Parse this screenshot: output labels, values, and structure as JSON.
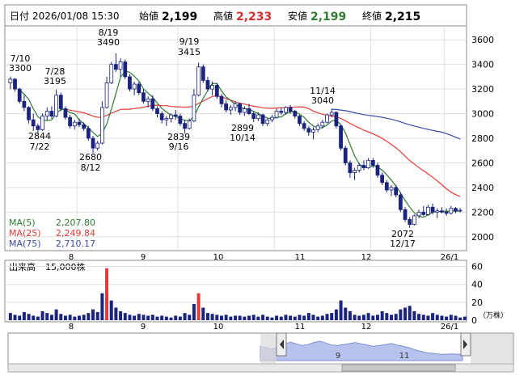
{
  "header": {
    "date_label": "日付",
    "datetime": "2026/01/08 15:30",
    "open_label": "始値",
    "open_value": "2,199",
    "high_label": "高値",
    "high_value": "2,233",
    "low_label": "安値",
    "low_value": "2,199",
    "close_label": "終値",
    "close_value": "2,215"
  },
  "legend": {
    "ma5_label": "MA(5)",
    "ma5_value": "2,207.80",
    "ma25_label": "MA(25)",
    "ma25_value": "2,249.84",
    "ma75_label": "MA(75)",
    "ma75_value": "2,710.17"
  },
  "volume_header": {
    "label": "出来高",
    "value": "15,000株"
  },
  "volume_unit": "（万株）",
  "navigator": {
    "tick_labels": [
      "9",
      "11"
    ]
  },
  "colors": {
    "up": "#ffffff",
    "down": "#1a237e",
    "candle_edge": "#1a237e",
    "ma5": "#2e7d32",
    "ma25": "#e53935",
    "ma75": "#3949ab",
    "volume_blue": "#1a237e",
    "volume_red": "#e53935",
    "open_value": "#000000",
    "high_value": "#d32f2f",
    "low_value": "#2e7d32"
  },
  "chart_data": {
    "type": "candlestick",
    "price_axis": {
      "ticks": [
        "2000",
        "2200",
        "2400",
        "2600",
        "2800",
        "3000",
        "3200",
        "3400",
        "3600"
      ],
      "ylim": [
        1900,
        3700
      ]
    },
    "volume_axis": {
      "ticks": [
        "0",
        "20",
        "40",
        "60"
      ],
      "ylim": [
        0,
        65
      ]
    },
    "x_tick_labels": [
      "8",
      "9",
      "10",
      "11",
      "12",
      "26/1"
    ],
    "annotations": [
      {
        "label": "7/10",
        "value": "3300"
      },
      {
        "label": "7/22",
        "value": "2844"
      },
      {
        "label": "7/28",
        "value": "3195"
      },
      {
        "label": "8/12",
        "value": "2680"
      },
      {
        "label": "8/19",
        "value": "3490"
      },
      {
        "label": "9/16",
        "value": "2839"
      },
      {
        "label": "9/19",
        "value": "3415"
      },
      {
        "label": "10/14",
        "value": "2899"
      },
      {
        "label": "11/14",
        "value": "3040"
      },
      {
        "label": "12/17",
        "value": "2072"
      }
    ],
    "candles": [
      [
        3250,
        3300,
        3200,
        3280
      ],
      [
        3280,
        3290,
        3180,
        3200
      ],
      [
        3200,
        3210,
        3080,
        3100
      ],
      [
        3100,
        3150,
        3020,
        3050
      ],
      [
        3050,
        3060,
        2920,
        2950
      ],
      [
        2950,
        3000,
        2860,
        2900
      ],
      [
        2900,
        2920,
        2844,
        2870
      ],
      [
        2870,
        3000,
        2860,
        2980
      ],
      [
        2980,
        3050,
        2950,
        3020
      ],
      [
        3020,
        3060,
        2960,
        2980
      ],
      [
        2980,
        3195,
        2970,
        3150
      ],
      [
        3150,
        3170,
        3020,
        3040
      ],
      [
        3040,
        3060,
        2950,
        2970
      ],
      [
        2970,
        2990,
        2880,
        2900
      ],
      [
        2900,
        2950,
        2870,
        2930
      ],
      [
        2930,
        2960,
        2890,
        2910
      ],
      [
        2910,
        2930,
        2860,
        2880
      ],
      [
        2880,
        2900,
        2780,
        2800
      ],
      [
        2800,
        2820,
        2680,
        2720
      ],
      [
        2720,
        2780,
        2700,
        2760
      ],
      [
        2760,
        3100,
        2750,
        3050
      ],
      [
        3050,
        3300,
        3040,
        3250
      ],
      [
        3250,
        3420,
        3240,
        3400
      ],
      [
        3400,
        3490,
        3340,
        3360
      ],
      [
        3360,
        3450,
        3300,
        3420
      ],
      [
        3420,
        3440,
        3280,
        3300
      ],
      [
        3300,
        3320,
        3180,
        3200
      ],
      [
        3200,
        3260,
        3150,
        3240
      ],
      [
        3240,
        3260,
        3150,
        3170
      ],
      [
        3170,
        3200,
        3080,
        3100
      ],
      [
        3100,
        3140,
        3050,
        3120
      ],
      [
        3120,
        3150,
        3020,
        3040
      ],
      [
        3040,
        3060,
        2970,
        3000
      ],
      [
        3000,
        3020,
        2920,
        2950
      ],
      [
        2950,
        2980,
        2900,
        2960
      ],
      [
        2960,
        3000,
        2930,
        2990
      ],
      [
        2990,
        3030,
        2950,
        2980
      ],
      [
        2980,
        3000,
        2900,
        2920
      ],
      [
        2920,
        2950,
        2839,
        2880
      ],
      [
        2880,
        2960,
        2870,
        2940
      ],
      [
        2940,
        3200,
        2930,
        3150
      ],
      [
        3150,
        3415,
        3140,
        3380
      ],
      [
        3380,
        3400,
        3250,
        3270
      ],
      [
        3270,
        3300,
        3180,
        3200
      ],
      [
        3200,
        3260,
        3150,
        3230
      ],
      [
        3230,
        3250,
        3120,
        3140
      ],
      [
        3140,
        3160,
        3050,
        3080
      ],
      [
        3080,
        3110,
        3010,
        3030
      ],
      [
        3030,
        3070,
        2990,
        3050
      ],
      [
        3050,
        3100,
        3020,
        3080
      ],
      [
        3080,
        3090,
        2990,
        3010
      ],
      [
        3010,
        3060,
        2980,
        3040
      ],
      [
        3040,
        3080,
        2990,
        3000
      ],
      [
        3000,
        3020,
        2930,
        2960
      ],
      [
        2960,
        3010,
        2940,
        2990
      ],
      [
        2990,
        3000,
        2899,
        2920
      ],
      [
        2920,
        2960,
        2900,
        2950
      ],
      [
        2950,
        2990,
        2930,
        2970
      ],
      [
        2970,
        3040,
        2960,
        3020
      ],
      [
        3020,
        3050,
        2990,
        3010
      ],
      [
        3010,
        3060,
        2990,
        3050
      ],
      [
        3050,
        3070,
        3000,
        3020
      ],
      [
        3020,
        3030,
        2960,
        2980
      ],
      [
        2980,
        2990,
        2900,
        2920
      ],
      [
        2920,
        2940,
        2860,
        2880
      ],
      [
        2880,
        2900,
        2820,
        2850
      ],
      [
        2850,
        2890,
        2790,
        2870
      ],
      [
        2870,
        2920,
        2850,
        2900
      ],
      [
        2900,
        2950,
        2880,
        2930
      ],
      [
        2930,
        3000,
        2920,
        2990
      ],
      [
        2990,
        3040,
        2970,
        3010
      ],
      [
        3010,
        3020,
        2880,
        2900
      ],
      [
        2900,
        2910,
        2700,
        2720
      ],
      [
        2720,
        2740,
        2580,
        2600
      ],
      [
        2600,
        2620,
        2480,
        2520
      ],
      [
        2520,
        2560,
        2460,
        2540
      ],
      [
        2540,
        2600,
        2520,
        2580
      ],
      [
        2580,
        2620,
        2540,
        2560
      ],
      [
        2560,
        2640,
        2550,
        2620
      ],
      [
        2620,
        2640,
        2560,
        2580
      ],
      [
        2580,
        2600,
        2480,
        2500
      ],
      [
        2500,
        2520,
        2420,
        2440
      ],
      [
        2440,
        2460,
        2360,
        2380
      ],
      [
        2380,
        2420,
        2330,
        2400
      ],
      [
        2400,
        2420,
        2320,
        2340
      ],
      [
        2340,
        2360,
        2200,
        2220
      ],
      [
        2220,
        2240,
        2120,
        2140
      ],
      [
        2140,
        2160,
        2072,
        2100
      ],
      [
        2100,
        2180,
        2090,
        2170
      ],
      [
        2170,
        2220,
        2150,
        2200
      ],
      [
        2200,
        2250,
        2170,
        2180
      ],
      [
        2180,
        2260,
        2170,
        2240
      ],
      [
        2240,
        2270,
        2180,
        2200
      ],
      [
        2200,
        2230,
        2150,
        2210
      ],
      [
        2210,
        2240,
        2190,
        2200
      ],
      [
        2200,
        2230,
        2170,
        2190
      ],
      [
        2190,
        2250,
        2180,
        2230
      ],
      [
        2230,
        2240,
        2190,
        2210
      ],
      [
        2210,
        2233,
        2199,
        2215
      ]
    ],
    "volume": [
      8,
      6,
      5,
      9,
      7,
      5,
      4,
      10,
      8,
      6,
      12,
      7,
      5,
      6,
      4,
      5,
      6,
      8,
      12,
      9,
      30,
      58,
      22,
      14,
      10,
      8,
      6,
      5,
      7,
      6,
      5,
      6,
      4,
      5,
      4,
      3,
      5,
      4,
      8,
      6,
      18,
      30,
      14,
      8,
      7,
      6,
      5,
      6,
      4,
      5,
      5,
      4,
      5,
      6,
      4,
      6,
      4,
      3,
      5,
      4,
      6,
      5,
      4,
      6,
      5,
      8,
      6,
      4,
      5,
      7,
      8,
      12,
      22,
      14,
      10,
      6,
      5,
      6,
      8,
      5,
      6,
      10,
      8,
      6,
      7,
      12,
      14,
      16,
      10,
      7,
      6,
      5,
      8,
      6,
      5,
      4,
      6,
      5,
      3,
      4
    ],
    "volume_red_indices": [
      21,
      41
    ],
    "navigator_series": [
      0.55,
      0.5,
      0.45,
      0.52,
      0.6,
      0.72,
      0.65,
      0.58,
      0.62,
      0.7,
      0.75,
      0.68,
      0.6,
      0.58,
      0.62,
      0.66,
      0.7,
      0.64,
      0.6,
      0.55,
      0.58,
      0.62,
      0.66,
      0.6,
      0.55,
      0.5,
      0.42,
      0.36,
      0.3,
      0.28,
      0.25,
      0.24,
      0.26,
      0.25,
      0.24
    ]
  }
}
